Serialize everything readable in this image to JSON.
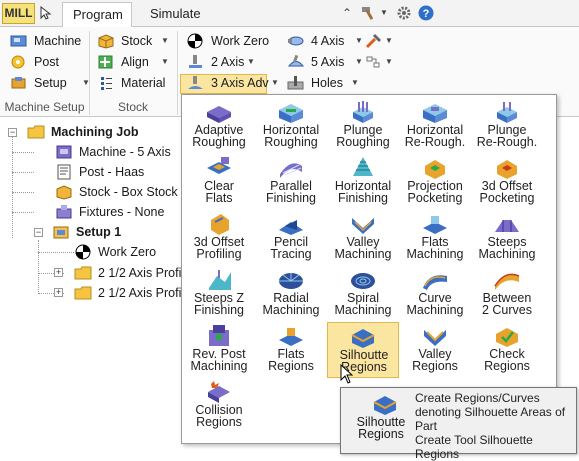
{
  "tabbar": {
    "mill_label": "MILL",
    "tabs": [
      "Program",
      "Simulate"
    ]
  },
  "ribbon": {
    "machine_setup": {
      "machine": "Machine",
      "post": "Post",
      "setup": "Setup",
      "group_label": "Machine Setup"
    },
    "stock": {
      "stock": "Stock",
      "align": "Align",
      "material": "Material",
      "group_label": "Stock"
    },
    "toolpath": {
      "work_zero": "Work Zero",
      "axis2": "2 Axis",
      "axis3adv": "3 Axis Adv",
      "axis4": "4 Axis",
      "axis5": "5 Axis",
      "holes": "Holes"
    }
  },
  "tree": {
    "root": "Machining Job",
    "machine": "Machine - 5 Axis",
    "post": "Post - Haas",
    "stock": "Stock - Box Stock",
    "fixtures": "Fixtures - None",
    "setup": "Setup 1",
    "work_zero": "Work Zero",
    "op1": "2 1/2 Axis Profil",
    "op2": "2 1/2 Axis Profil"
  },
  "menu": {
    "items": [
      "Adaptive\nRoughing",
      "Horizontal\nRoughing",
      "Plunge\nRoughing",
      "Horizontal\nRe-Rough.",
      "Plunge\nRe-Rough.",
      "Clear\nFlats",
      "Parallel\nFinishing",
      "Horizontal\nFinishing",
      "Projection\nPocketing",
      "3d Offset\nPocketing",
      "3d Offset\nProfiling",
      "Pencil\nTracing",
      "Valley\nMachining",
      "Flats\nMachining",
      "Steeps\nMachining",
      "Steeps  Z\nFinishing",
      "Radial\nMachining",
      "Spiral\nMachining",
      "Curve\nMachining",
      "Between\n2 Curves",
      "Rev. Post\nMachining",
      "Flats\nRegions",
      "Silhoutte\nRegions",
      "Valley\nRegions",
      "Check\nRegions",
      "Collision\nRegions"
    ],
    "highlighted": "Silhoutte\nRegions"
  },
  "tooltip": {
    "title": "Silhoutte\nRegions",
    "line1": "Create Regions/Curves denoting Silhouette Areas of Part",
    "line2": "Create Tool Silhouette Regions"
  },
  "colors": {
    "accent_yellow": "#fbe6a1",
    "icon_blue": "#3a6fc4",
    "icon_orange": "#e8a32c",
    "icon_purple": "#7a6cc8"
  }
}
